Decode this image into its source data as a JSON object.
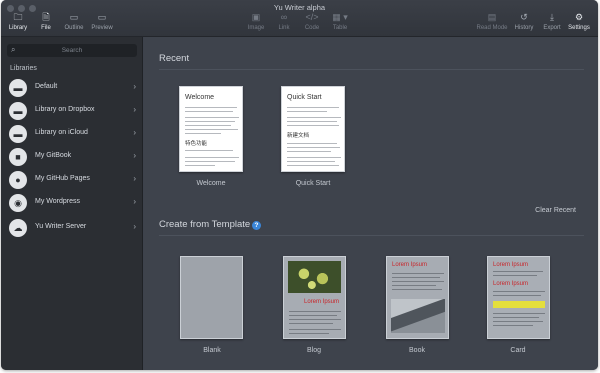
{
  "window": {
    "title": "Yu Writer alpha"
  },
  "toolbar": {
    "left": [
      {
        "label": "Library",
        "icon": "folder-icon"
      },
      {
        "label": "File",
        "icon": "file-icon"
      },
      {
        "label": "Outline",
        "icon": "outline-icon"
      },
      {
        "label": "Preview",
        "icon": "preview-icon"
      }
    ],
    "center": [
      {
        "label": "Image",
        "icon": "image-icon"
      },
      {
        "label": "Link",
        "icon": "link-icon"
      },
      {
        "label": "Code",
        "icon": "code-icon"
      },
      {
        "label": "Table",
        "icon": "table-icon"
      }
    ],
    "right": [
      {
        "label": "Read Mode",
        "icon": "read-mode-icon"
      },
      {
        "label": "History",
        "icon": "history-icon"
      },
      {
        "label": "Export",
        "icon": "export-icon"
      },
      {
        "label": "Settings",
        "icon": "gear-icon"
      }
    ]
  },
  "sidebar": {
    "search_placeholder": "Search",
    "libraries_heading": "Libraries",
    "items": [
      {
        "label": "Default",
        "icon": "folder-icon"
      },
      {
        "label": "Library on Dropbox",
        "icon": "folder-icon"
      },
      {
        "label": "Library on iCloud",
        "icon": "folder-icon"
      },
      {
        "label": "My GitBook",
        "icon": "book-icon"
      },
      {
        "label": "My GitHub Pages",
        "icon": "github-icon"
      },
      {
        "label": "My Wordpress",
        "icon": "wordpress-icon"
      },
      {
        "label": "Yu Writer Server",
        "icon": "cloud-icon"
      }
    ]
  },
  "main": {
    "recent_title": "Recent",
    "recent_docs": [
      {
        "preview_title": "Welcome",
        "caption": "Welcome",
        "preview_heading": "特色功能"
      },
      {
        "preview_title": "Quick Start",
        "caption": "Quick Start",
        "preview_heading": "新建文档"
      }
    ],
    "clear_recent": "Clear Recent",
    "template_title": "Create from Template",
    "templates": [
      {
        "caption": "Blank"
      },
      {
        "caption": "Blog",
        "heading": "Lorem Ipsum"
      },
      {
        "caption": "Book",
        "heading": "Lorem Ipsum"
      },
      {
        "caption": "Card",
        "heading": "Lorem Ipsum",
        "heading2": "Lorem Ipsum"
      }
    ]
  }
}
